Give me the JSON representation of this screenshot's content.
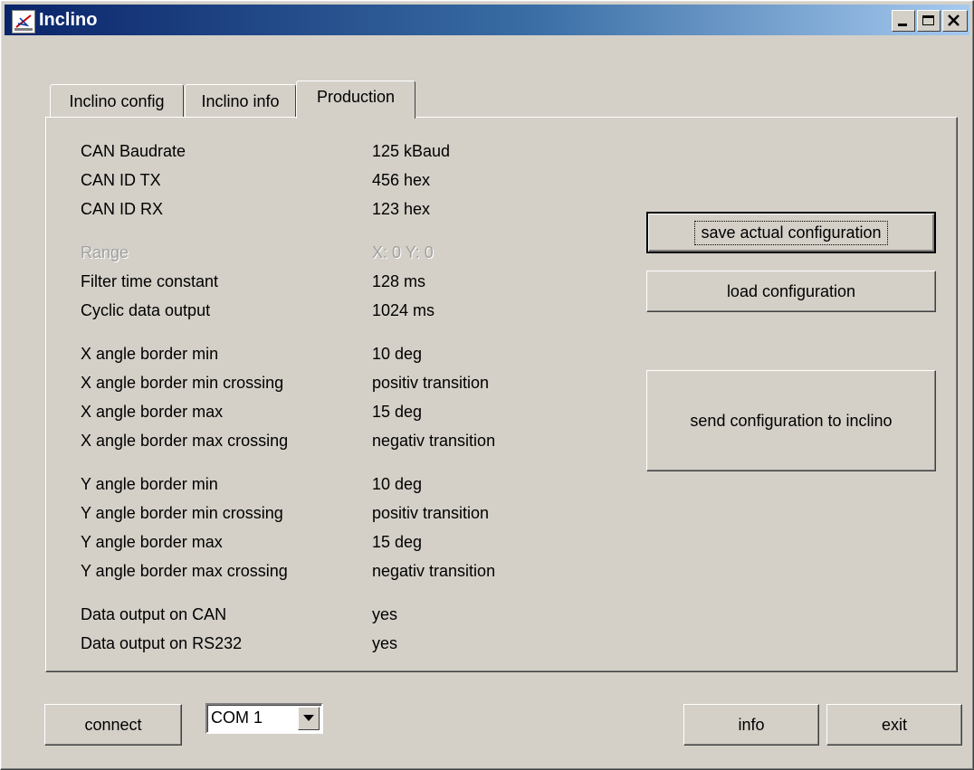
{
  "window": {
    "title": "Inclino"
  },
  "tabs": [
    {
      "label": "Inclino config"
    },
    {
      "label": "Inclino info"
    },
    {
      "label": "Production"
    }
  ],
  "settings": [
    {
      "label": "CAN Baudrate",
      "value": "125 kBaud"
    },
    {
      "label": "CAN ID TX",
      "value": "456 hex"
    },
    {
      "label": "CAN ID RX",
      "value": "123 hex"
    },
    {
      "label": "Range",
      "value": "X: 0  Y: 0"
    },
    {
      "label": "Filter time constant",
      "value": "128 ms"
    },
    {
      "label": "Cyclic data output",
      "value": "1024 ms"
    },
    {
      "label": "X angle border min",
      "value": "10 deg"
    },
    {
      "label": "X angle border min crossing",
      "value": "positiv transition"
    },
    {
      "label": "X angle border max",
      "value": "15 deg"
    },
    {
      "label": "X angle border max crossing",
      "value": "negativ transition"
    },
    {
      "label": "Y angle border min",
      "value": "10 deg"
    },
    {
      "label": "Y angle border min crossing",
      "value": "positiv transition"
    },
    {
      "label": "Y angle border max",
      "value": "15 deg"
    },
    {
      "label": "Y angle border max crossing",
      "value": "negativ transition"
    },
    {
      "label": "Data output on CAN",
      "value": "yes"
    },
    {
      "label": "Data output on RS232",
      "value": "yes"
    }
  ],
  "buttons": {
    "save": "save actual configuration",
    "load": "load configuration",
    "send": "send configuration to inclino",
    "connect": "connect",
    "info": "info",
    "exit": "exit"
  },
  "port": {
    "selected": "COM 1"
  }
}
